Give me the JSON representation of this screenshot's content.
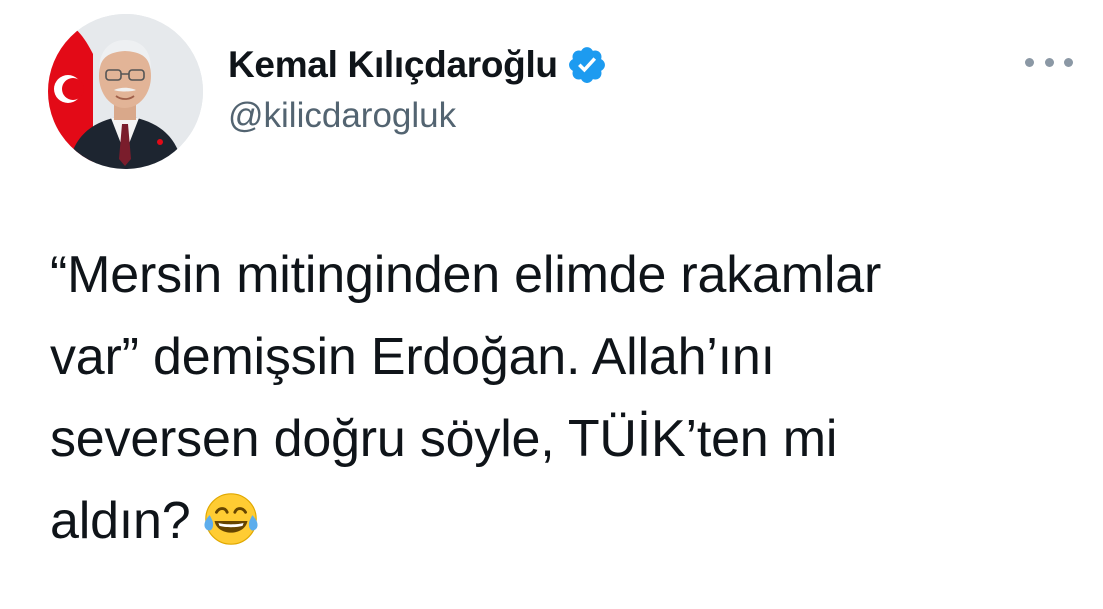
{
  "author": {
    "display_name": "Kemal Kılıçdaroğlu",
    "handle": "@kilicdarogluk",
    "verified": true
  },
  "tweet": {
    "lines": [
      "“Mersin mitinginden elimde rakamlar",
      "var” demişsin Erdoğan. Allah’ını",
      "seversen doğru söyle, TÜİK’ten mi",
      "aldın?"
    ],
    "emoji": "face-with-tears-of-joy"
  },
  "colors": {
    "text": "#0f1419",
    "secondary": "#536471",
    "verified_blue": "#1d9bf0",
    "flag_red": "#e30a17"
  },
  "icons": {
    "verified": "verified-badge-icon",
    "more": "more-options-icon",
    "emoji": "face-with-tears-of-joy-icon"
  }
}
